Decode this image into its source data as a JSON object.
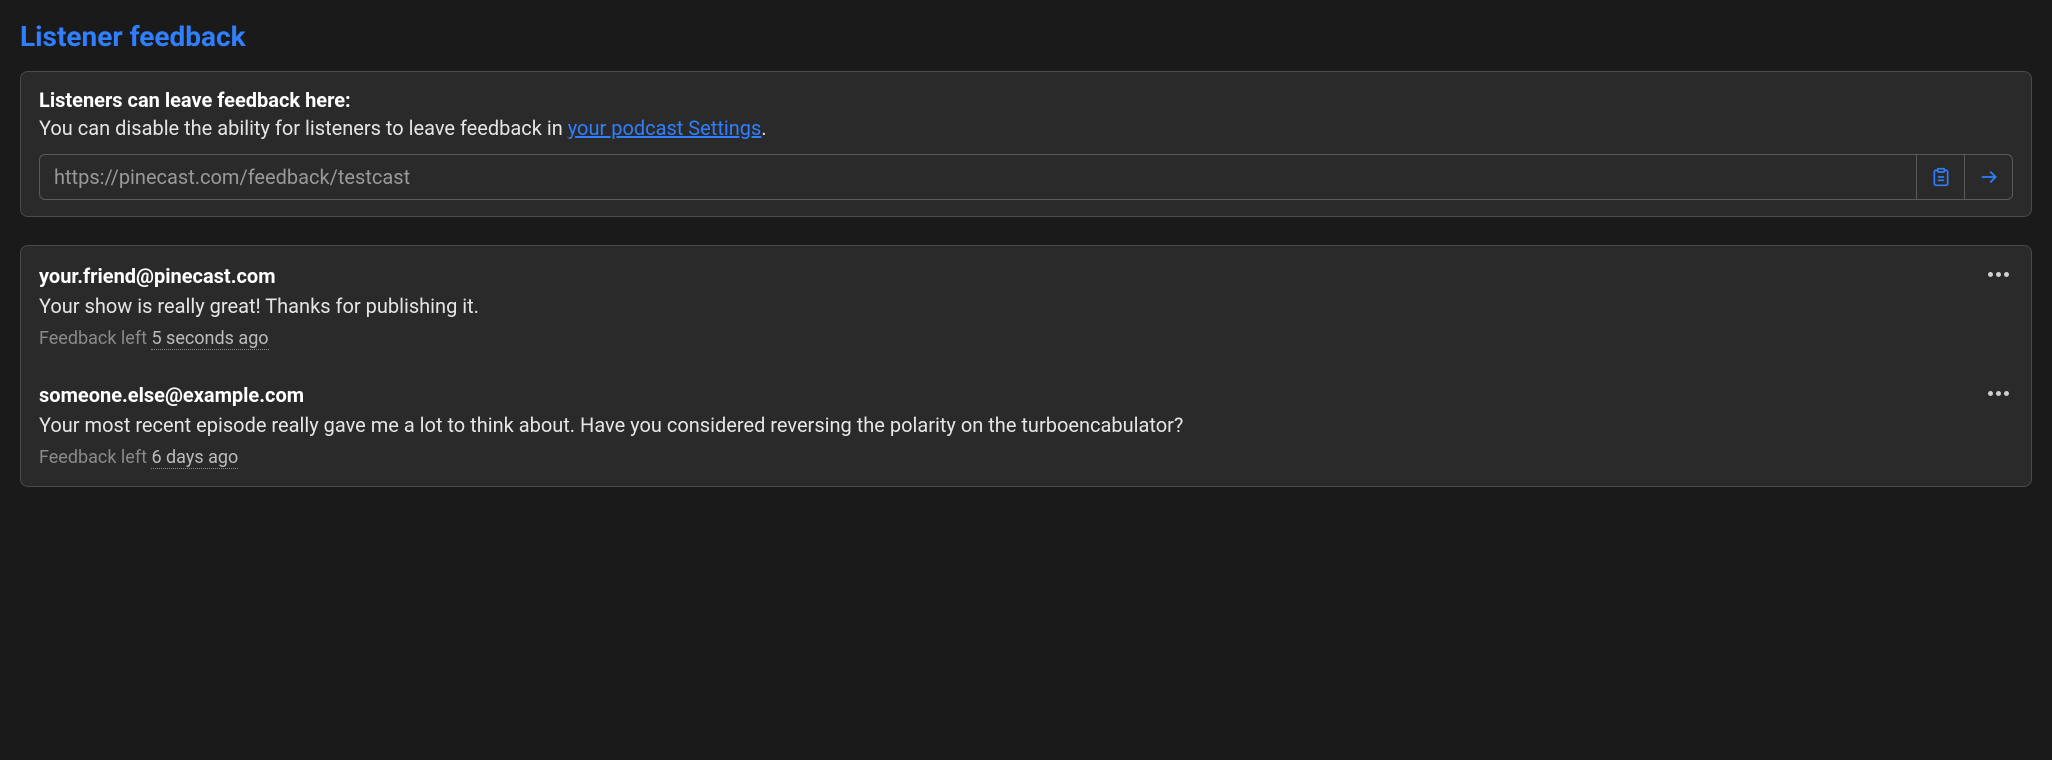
{
  "colors": {
    "accent": "#2f7fff",
    "background": "#1a1a1a",
    "card": "#2a2a2a",
    "border": "#4a4a4a"
  },
  "title": "Listener feedback",
  "info": {
    "heading": "Listeners can leave feedback here:",
    "subtext_prefix": "You can disable the ability for listeners to leave feedback in ",
    "settings_link_text": "your podcast Settings",
    "subtext_suffix": ".",
    "url": "https://pinecast.com/feedback/testcast"
  },
  "icons": {
    "clipboard": "clipboard-icon",
    "open": "arrow-right-icon",
    "more": "more-horizontal-icon"
  },
  "feedback": [
    {
      "email": "your.friend@pinecast.com",
      "body": "Your show is really great! Thanks for publishing it.",
      "meta_prefix": "Feedback left ",
      "time": "5 seconds ago"
    },
    {
      "email": "someone.else@example.com",
      "body": "Your most recent episode really gave me a lot to think about. Have you considered reversing the polarity on the turboencabulator?",
      "meta_prefix": "Feedback left ",
      "time": "6 days ago"
    }
  ]
}
